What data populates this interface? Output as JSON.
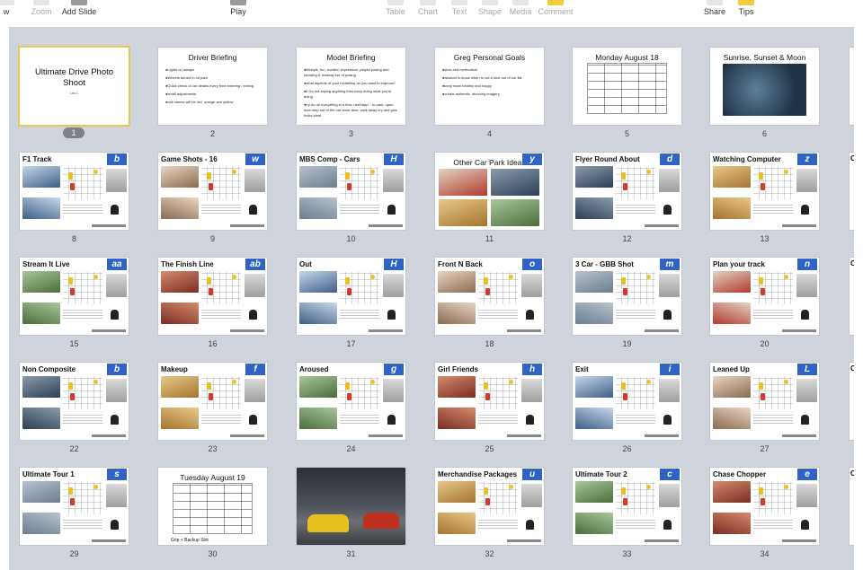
{
  "toolbar": {
    "left": [
      {
        "label": "w",
        "icon": "view-icon",
        "dim": false
      },
      {
        "label": "Zoom",
        "icon": "zoom-icon",
        "dim": true
      },
      {
        "label": "Add Slide",
        "icon": "add-slide-icon",
        "dim": false
      }
    ],
    "center": [
      {
        "label": "Play",
        "icon": "play-icon",
        "dim": false
      }
    ],
    "insert": [
      {
        "label": "Table",
        "icon": "table-icon",
        "dim": true
      },
      {
        "label": "Chart",
        "icon": "chart-icon",
        "dim": true
      },
      {
        "label": "Text",
        "icon": "text-icon",
        "dim": true
      },
      {
        "label": "Shape",
        "icon": "shape-icon",
        "dim": true
      },
      {
        "label": "Media",
        "icon": "media-icon",
        "dim": true
      },
      {
        "label": "Comment",
        "icon": "comment-icon",
        "dim": true
      }
    ],
    "right": [
      {
        "label": "Share",
        "icon": "share-icon",
        "dim": false
      },
      {
        "label": "Tips",
        "icon": "tips-icon",
        "dim": false
      }
    ]
  },
  "slides": [
    {
      "number": "1",
      "kind": "title",
      "title": "Ultimate Drive Photo Shoot",
      "subtitle": "Les L",
      "selected": true
    },
    {
      "number": "2",
      "kind": "bullets",
      "title": "Driver Briefing",
      "bullets": [
        "Lights on always",
        "Wheels turned in on park",
        "Quick check of car details every time entering / exiting",
        "small adjustments",
        "call names will be red, orange and yellow"
      ]
    },
    {
      "number": "3",
      "kind": "bullets",
      "title": "Model Briefing",
      "bullets": [
        "lifestyle, fun, excited, expression, playful posing and knowing it, making use of posing",
        "what aspects of your modelling do you want to improve?",
        "if I'm not saying anything then keep doing what you're doing",
        "try do do everything in a flow, next step... to park, open door step out of the car close door, walk away cry and give looks ideal"
      ]
    },
    {
      "number": "4",
      "kind": "bullets",
      "title": "Greg Personal Goals",
      "bullets": [
        "slow and methodical",
        "wisdom to know when to cut a shot out of our list",
        "keep team healthy and happy",
        "create authentic, stunning imagery"
      ]
    },
    {
      "number": "5",
      "kind": "table",
      "title": "Monday August 18"
    },
    {
      "number": "6",
      "kind": "map",
      "title": "Sunrise, Sunset & Moon"
    },
    {
      "number": "8",
      "kind": "plan",
      "title": "F1 Track",
      "letter": "b"
    },
    {
      "number": "9",
      "kind": "plan",
      "title": "Game Shots - 16",
      "letter": "w"
    },
    {
      "number": "10",
      "kind": "plan",
      "title": "MBS Comp - Cars",
      "letter": "H"
    },
    {
      "number": "11",
      "kind": "grid4",
      "title": "Other Car Park Ideas",
      "letter": "y"
    },
    {
      "number": "12",
      "kind": "plan",
      "title": "Flyer Round About",
      "letter": "d"
    },
    {
      "number": "13",
      "kind": "plan",
      "title": "Watching Computer",
      "letter": "z"
    },
    {
      "number": "15",
      "kind": "plan",
      "title": "Stream It Live",
      "letter": "aa"
    },
    {
      "number": "16",
      "kind": "plan",
      "title": "The Finish Line",
      "letter": "ab"
    },
    {
      "number": "17",
      "kind": "plan",
      "title": "Out",
      "letter": "H"
    },
    {
      "number": "18",
      "kind": "plan",
      "title": "Front N Back",
      "letter": "o"
    },
    {
      "number": "19",
      "kind": "plan",
      "title": "3 Car - GBB Shot",
      "letter": "m"
    },
    {
      "number": "20",
      "kind": "plan",
      "title": "Plan your track",
      "letter": "n"
    },
    {
      "number": "22",
      "kind": "plan",
      "title": "Non Composite",
      "letter": "b"
    },
    {
      "number": "23",
      "kind": "plan",
      "title": "Makeup",
      "letter": "f"
    },
    {
      "number": "24",
      "kind": "plan",
      "title": "Aroused",
      "letter": "g"
    },
    {
      "number": "25",
      "kind": "plan",
      "title": "Girl Friends",
      "letter": "h"
    },
    {
      "number": "26",
      "kind": "plan",
      "title": "Exit",
      "letter": "i"
    },
    {
      "number": "27",
      "kind": "plan",
      "title": "Leaned Up",
      "letter": "L"
    },
    {
      "number": "29",
      "kind": "plan",
      "title": "Ultimate Tour 1",
      "letter": "s"
    },
    {
      "number": "30",
      "kind": "table",
      "title": "Tuesday August 19",
      "caption": "Grip + Backup Slot"
    },
    {
      "number": "31",
      "kind": "photo",
      "title": ""
    },
    {
      "number": "32",
      "kind": "plan",
      "title": "Merchandise Packages",
      "letter": "u"
    },
    {
      "number": "33",
      "kind": "plan",
      "title": "Ultimate Tour 2",
      "letter": "c"
    },
    {
      "number": "34",
      "kind": "plan",
      "title": "Chase Chopper",
      "letter": "e"
    }
  ],
  "edge_row_labels": [
    "L",
    "C",
    "C",
    "C",
    "C"
  ],
  "colors": {
    "selection": "#e2c74c",
    "letter_badge": "#2f63c6",
    "background": "#cfd3db"
  }
}
